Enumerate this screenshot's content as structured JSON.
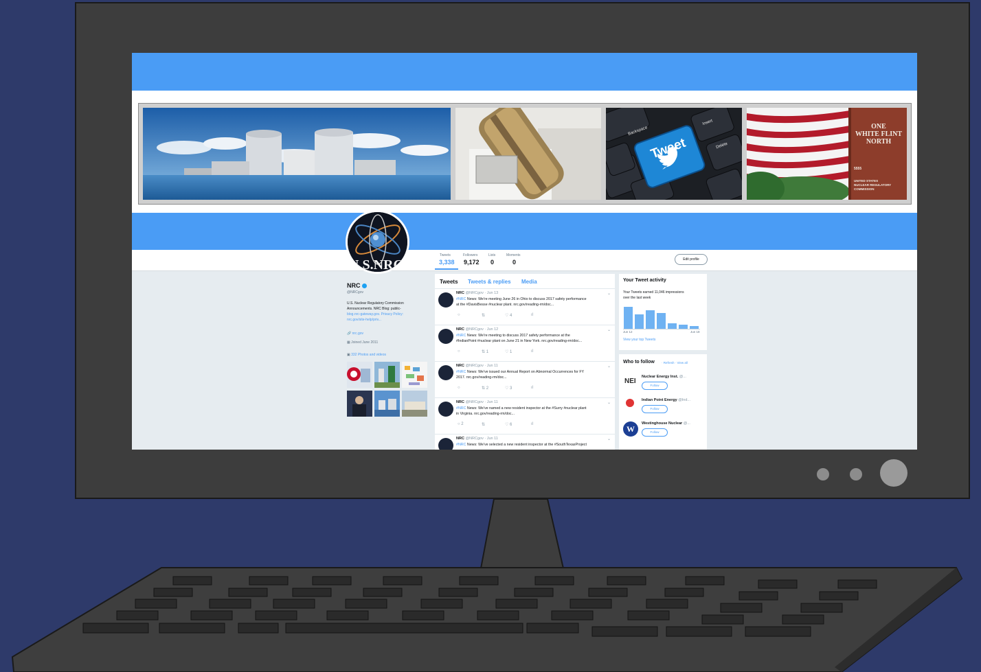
{
  "profile": {
    "name": "NRC",
    "handle": "@NRCgov",
    "bio_line1": "U.S. Nuclear Regulatory Commission",
    "bio_line2": "Announcements. NRC Blog: public-",
    "bio_line3": "blog.nrc-gateway.gov. Privacy Policy:",
    "bio_line4": "nrc.gov/site-help/priv...",
    "location": "nrc.gov",
    "joined": "Joined June 2011",
    "media_link": "332 Photos and videos",
    "avatar_text": "U.S.NRC"
  },
  "stats": [
    {
      "label": "Tweets",
      "value": "3,338"
    },
    {
      "label": "Followers",
      "value": "9,172"
    },
    {
      "label": "Lists",
      "value": "0"
    },
    {
      "label": "Moments",
      "value": "0"
    }
  ],
  "edit_profile_label": "Edit profile",
  "banner": {
    "tweet_key": "Tweet",
    "key_backspace": "Backspace",
    "key_insert": "Insert",
    "key_delete": "Delete",
    "sign_line1": "ONE",
    "sign_line2": "WHITE FLINT",
    "sign_line3": "NORTH",
    "sign_number": "5555",
    "sign_footer1": "UNITED STATES",
    "sign_footer2": "NUCLEAR REGULATORY",
    "sign_footer3": "COMMISSION"
  },
  "tabs": {
    "tweets": "Tweets",
    "replies": "Tweets & replies",
    "media": "Media"
  },
  "tweets": [
    {
      "name": "NRC",
      "handle": "@NRCgov · Jun 13",
      "line1_tag": "#NRC",
      "line1": " News: We're meeting June 26 in Ohio to discuss 2017 safety performance",
      "line2": "at the #DavisBesse #nuclear plant. nrc.gov/reading-rm/doc...",
      "retweets": "",
      "likes": "4"
    },
    {
      "name": "NRC",
      "handle": "@NRCgov · Jun 12",
      "line1_tag": "#NRC",
      "line1": " News: We're meeting to discuss 2017 safety performance at the",
      "line2": "#IndianPoint #nuclear plant on June 21 in New York. nrc.gov/reading-rm/doc...",
      "retweets": "1",
      "likes": "1"
    },
    {
      "name": "NRC",
      "handle": "@NRCgov · Jun 11",
      "line1_tag": "#NRC",
      "line1": " News: We've issued our Annual Report on Abnormal Occurrences for FY",
      "line2": "2017. nrc.gov/reading-rm/doc...",
      "retweets": "2",
      "likes": "3"
    },
    {
      "name": "NRC",
      "handle": "@NRCgov · Jun 11",
      "line1_tag": "#NRC",
      "line1": " News: We've named a new resident inspector at the #Surry #nuclear plant",
      "line2": "in Virginia. nrc.gov/reading-rm/doc...",
      "retweets": "",
      "likes": "6",
      "replies": "2"
    },
    {
      "name": "NRC",
      "handle": "@NRCgov · Jun 11",
      "line1_tag": "#NRC",
      "line1": " News: We've selected a new resident inspector at the #SouthTexasProject",
      "line2": "",
      "retweets": "",
      "likes": ""
    }
  ],
  "activity": {
    "title": "Your Tweet activity",
    "line1": "Your Tweets earned 11,046 impressions",
    "line2": "over the last week",
    "date_start": "Jun 12",
    "date_end": "Jun 18",
    "link": "View your top Tweets",
    "bars": [
      0.85,
      0.55,
      0.7,
      0.6,
      0.2,
      0.15,
      0.1
    ]
  },
  "who_to_follow": {
    "title": "Who to follow",
    "refresh": "· Refresh · View all",
    "follow_label": "Follow",
    "accounts": [
      {
        "name": "Nuclear Energy Inst.",
        "handle": "@...",
        "logo": "NEI"
      },
      {
        "name": "Indian Point Energy",
        "handle": "@Ind...",
        "logo": ""
      },
      {
        "name": "Westinghouse Nuclear",
        "handle": "@...",
        "logo": "W"
      }
    ]
  }
}
